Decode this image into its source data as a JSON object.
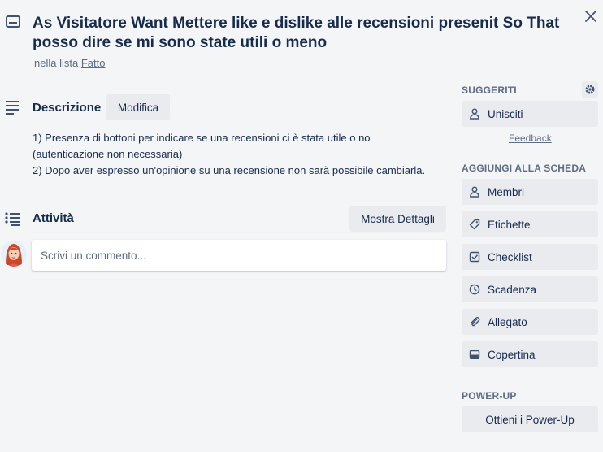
{
  "card": {
    "title": "As Visitatore Want Mettere like e dislike alle recensioni presenit So That posso dire se mi sono state utili o meno",
    "list_prefix": "nella lista",
    "list_name": "Fatto"
  },
  "description": {
    "heading": "Descrizione",
    "edit_label": "Modifica",
    "lines": [
      "1) Presenza di bottoni per indicare se una recensioni ci è stata utile o no",
      "(autenticazione non necessaria)",
      "2) Dopo aver espresso un'opinione su una recensione non sarà possibile cambiarla."
    ]
  },
  "activity": {
    "heading": "Attività",
    "details_label": "Mostra Dettagli",
    "comment_placeholder": "Scrivi un commento..."
  },
  "sidebar": {
    "suggested_heading": "SUGGERITI",
    "join_label": "Unisciti",
    "feedback_label": "Feedback",
    "add_heading": "AGGIUNGI ALLA SCHEDA",
    "add_items": [
      {
        "label": "Membri",
        "icon": "person-icon"
      },
      {
        "label": "Etichette",
        "icon": "tag-icon"
      },
      {
        "label": "Checklist",
        "icon": "checklist-icon"
      },
      {
        "label": "Scadenza",
        "icon": "clock-icon"
      },
      {
        "label": "Allegato",
        "icon": "paperclip-icon"
      },
      {
        "label": "Copertina",
        "icon": "cover-icon"
      }
    ],
    "powerup_heading": "POWER-UP",
    "powerup_button": "Ottieni i Power-Up"
  },
  "colors": {
    "background": "#f4f5f7",
    "button": "#e9ebee",
    "text": "#172b4d",
    "muted": "#5e6c84"
  }
}
